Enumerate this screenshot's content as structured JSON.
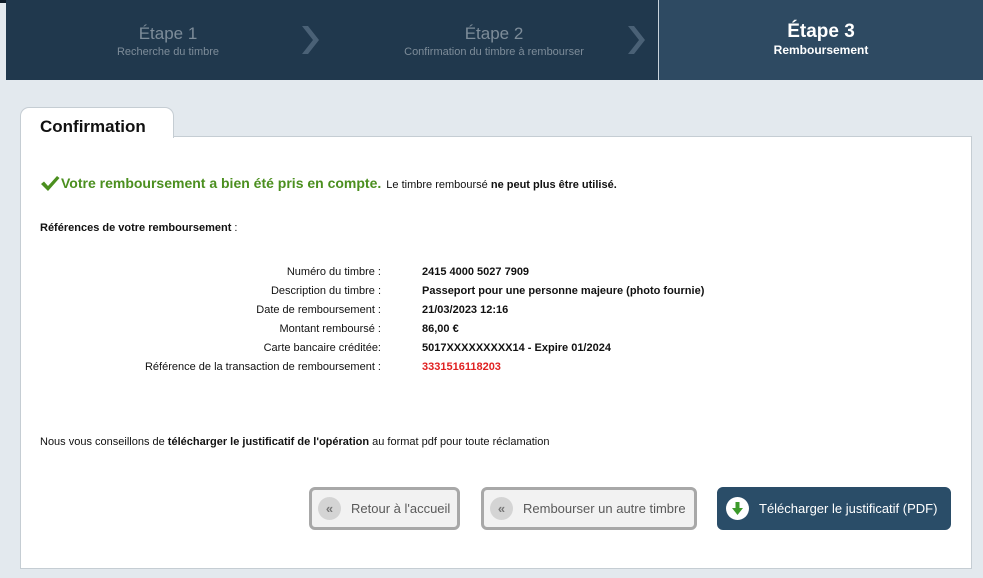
{
  "steps": [
    {
      "title": "Étape 1",
      "subtitle": "Recherche du timbre"
    },
    {
      "title": "Étape 2",
      "subtitle": "Confirmation du timbre à rembourser"
    },
    {
      "title": "Étape 3",
      "subtitle": "Remboursement"
    }
  ],
  "active_step": 3,
  "tab_label": "Confirmation",
  "success": {
    "main": "Votre remboursement a bien été pris en compte.",
    "note_prefix": "Le timbre remboursé",
    "note_bold": "ne peut plus être utilisé."
  },
  "references": {
    "label": "Références de votre remboursement",
    "suffix": " :"
  },
  "details": [
    {
      "label": "Numéro du timbre :",
      "value": "2415 4000 5027 7909"
    },
    {
      "label": "Description du timbre :",
      "value": "Passeport pour une personne majeure (photo fournie)"
    },
    {
      "label": "Date de remboursement :",
      "value": "21/03/2023 12:16"
    },
    {
      "label": "Montant remboursé :",
      "value": "86,00 €"
    },
    {
      "label": "Carte bancaire créditée:",
      "value": "5017XXXXXXXXX14 - Expire 01/2024"
    },
    {
      "label": "Référence de la transaction de remboursement :",
      "value": "3331516118203"
    }
  ],
  "advice": {
    "prefix": "Nous vous conseillons de ",
    "bold": "télécharger le justificatif de l'opération",
    "suffix": " au format pdf pour toute réclamation"
  },
  "buttons": {
    "home": "Retour à l'accueil",
    "other": "Rembourser un autre timbre",
    "pdf": "Télécharger le justificatif (PDF)"
  },
  "icons": {
    "back": "«",
    "check": "check-icon",
    "download": "download-icon"
  },
  "colors": {
    "header_bg": "#20384d",
    "active_step_bg": "#2e4a62",
    "success_green": "#4b8f1f",
    "transaction_red": "#e02020",
    "primary_button": "#2a4d68"
  }
}
